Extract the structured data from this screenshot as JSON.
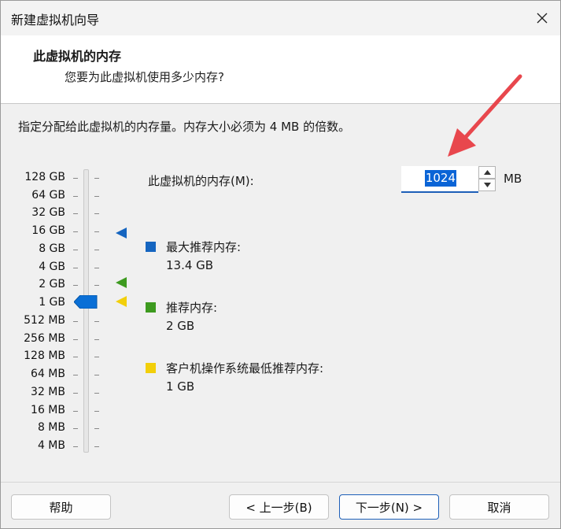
{
  "window": {
    "title": "新建虚拟机向导"
  },
  "header": {
    "title": "此虚拟机的内存",
    "subtitle": "您要为此虚拟机使用多少内存?"
  },
  "instruction": "指定分配给此虚拟机的内存量。内存大小必须为 4 MB 的倍数。",
  "scale": [
    "128 GB",
    "64 GB",
    "32 GB",
    "16 GB",
    "8 GB",
    "4 GB",
    "2 GB",
    "1 GB",
    "512 MB",
    "256 MB",
    "128 MB",
    "64 MB",
    "32 MB",
    "16 MB",
    "8 MB",
    "4 MB"
  ],
  "memory": {
    "label": "此虚拟机的内存(M):",
    "value": "1024",
    "unit": "MB",
    "selected_scale": "1 GB"
  },
  "legend": [
    {
      "label": "最大推荐内存:",
      "value": "13.4 GB",
      "color": "#1565c0"
    },
    {
      "label": "推荐内存:",
      "value": "2 GB",
      "color": "#3d9a1f"
    },
    {
      "label": "客户机操作系统最低推荐内存:",
      "value": "1 GB",
      "color": "#f2cf0a"
    }
  ],
  "buttons": {
    "help": "帮助",
    "back": "< 上一步(B)",
    "next": "下一步(N) >",
    "cancel": "取消"
  },
  "colors": {
    "accent": "#1d5fb8",
    "selection": "#0a64d6",
    "annotation_arrow": "#e8474d"
  }
}
